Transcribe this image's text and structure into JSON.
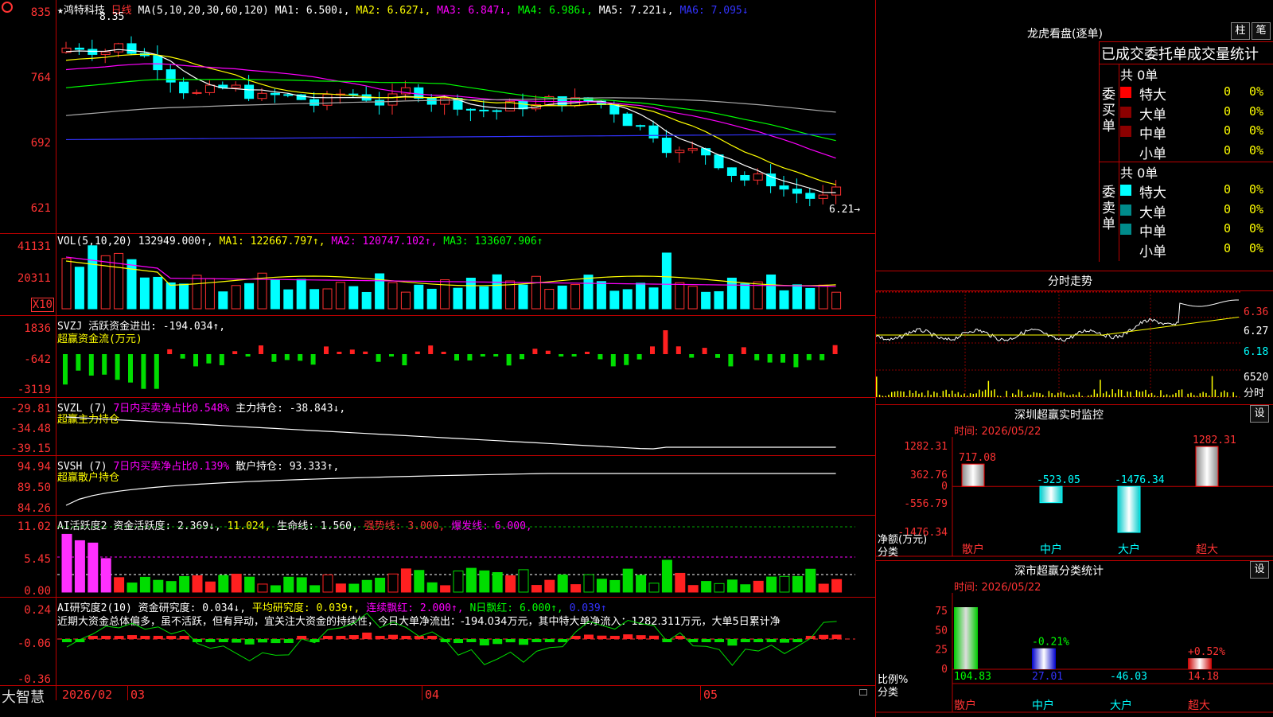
{
  "app": {
    "brand": "大智慧"
  },
  "kline": {
    "stock_star": "★",
    "stock_name": "鸿特科技",
    "period": "日线",
    "ma_label": "MA(5,10,20,30,60,120)",
    "ma1": "MA1: 6.500↓,",
    "ma2": "MA2: 6.627↓,",
    "ma3": "MA3: 6.847↓,",
    "ma4": "MA4: 6.986↓,",
    "ma5": "MA5: 7.221↓,",
    "ma6": "MA6: 7.095↓",
    "high_mark": "8.35",
    "low_mark": "6.21→",
    "y_ticks": [
      "835",
      "764",
      "692",
      "621"
    ]
  },
  "vol": {
    "label": "VOL(5,10,20)",
    "value": "132949.000↑,",
    "ma1": "MA1: 122667.797↑,",
    "ma2": "MA2: 120747.102↑,",
    "ma3": "MA3: 133607.906↑",
    "y_ticks": [
      "41131",
      "20311"
    ],
    "unit": "X10"
  },
  "svzj": {
    "label": "SVZJ",
    "title": "活跃资金进出: -194.034↑,",
    "subtitle": "超赢资金流(万元)",
    "y_ticks": [
      "1836",
      "-642",
      "-3119"
    ]
  },
  "svzl": {
    "label": "SVZL (7)",
    "text1": "7日内买卖净占比0.548%",
    "text2": "主力持仓: -38.843↓,",
    "subtitle": "超赢主力持仓",
    "y_ticks": [
      "-29.81",
      "-34.48",
      "-39.15"
    ]
  },
  "svsh": {
    "label": "SVSH (7)",
    "text1": "7日内买卖净占比0.139%",
    "text2": "散户持仓: 93.333↑,",
    "subtitle": "超赢散户持仓",
    "y_ticks": [
      "94.94",
      "89.50",
      "84.26"
    ]
  },
  "ai1": {
    "label": "AI活跃度2",
    "t1": "资金活跃度: 2.369↓,",
    "t2": "11.024,",
    "t3": "生命线: 1.560,",
    "t4": "强势线: 3.000,",
    "t5": "爆发线: 6.000,",
    "y_ticks": [
      "11.02",
      "5.45",
      "0.00"
    ]
  },
  "ai2": {
    "label": "AI研究度2(10)",
    "t1": "资金研究度: 0.034↓,",
    "t2": "平均研究度: 0.039↑,",
    "t3": "连续飘红: 2.000↑,",
    "t4": "N日飘红: 6.000↑,",
    "t5": "0.039↑",
    "commentary": "近期大资金总体偏多，虽不活跃，但有异动，宜关注大资金的持续性，今日大单净流出：-194.034万元，其中特大单净流入：1282.311万元，大单5日累计净",
    "y_ticks": [
      "0.24",
      "-0.06",
      "-0.36"
    ]
  },
  "xaxis": {
    "labels": [
      "2026/02",
      "03",
      "04",
      "05"
    ]
  },
  "longhu": {
    "title": "龙虎看盘(逐单)",
    "btn1": "柱",
    "btn2": "笔",
    "header": "已成交委托单成交量统计",
    "buy_side": "委买单",
    "sell_side": "委卖单",
    "buy_total": "共 0单",
    "sell_total": "共 0单",
    "rows": [
      {
        "name": "特大",
        "count": "0",
        "pct": "0%"
      },
      {
        "name": "大单",
        "count": "0",
        "pct": "0%"
      },
      {
        "name": "中单",
        "count": "0",
        "pct": "0%"
      },
      {
        "name": "小单",
        "count": "0",
        "pct": "0%"
      }
    ],
    "buy_colors": [
      "#ff0000",
      "#8b0000",
      "#8b0000",
      "#000000"
    ],
    "sell_colors": [
      "#00ffff",
      "#008b8b",
      "#008b8b",
      "#000000"
    ]
  },
  "fenshi": {
    "title": "分时走势",
    "y_ticks": [
      "6.36",
      "6.27",
      "6.18"
    ],
    "vol_tick": "6520",
    "vol_unit": "分时"
  },
  "monitor": {
    "title": "深圳超赢实时监控",
    "btn": "设",
    "time": "时间: 2026/05/22",
    "y_ticks": [
      "1282.31",
      "362.76",
      "0",
      "-556.79",
      "-1476.34"
    ],
    "ylabel": "净额(万元)",
    "xlabel": "分类",
    "categories": [
      "散户",
      "中户",
      "大户",
      "超大"
    ],
    "values": [
      "717.08",
      "-523.05",
      "-1476.34",
      "1282.31"
    ]
  },
  "classify": {
    "title": "深市超赢分类统计",
    "btn": "设",
    "time": "时间: 2026/05/22",
    "y_ticks": [
      "75",
      "50",
      "25",
      "0"
    ],
    "ylabel": "比例%",
    "xlabel": "分类",
    "categories": [
      "散户",
      "中户",
      "大户",
      "超大"
    ],
    "bottom_values": [
      "104.83",
      "27.01",
      "-46.03",
      "14.18"
    ],
    "top_values": [
      "",
      "-0.21%",
      "",
      "+0.52%"
    ]
  },
  "chart_data": [
    {
      "type": "bar",
      "title": "深圳超赢实时监控",
      "categories": [
        "散户",
        "中户",
        "大户",
        "超大"
      ],
      "values": [
        717.08,
        -523.05,
        -1476.34,
        1282.31
      ],
      "ylabel": "净额(万元)",
      "ylim": [
        -1476.34,
        1282.31
      ]
    },
    {
      "type": "bar",
      "title": "深市超赢分类统计",
      "categories": [
        "散户",
        "中户",
        "大户",
        "超大"
      ],
      "values": [
        104.83,
        27.01,
        -46.03,
        14.18
      ],
      "ylabel": "比例%",
      "ylim": [
        0,
        100
      ]
    }
  ]
}
